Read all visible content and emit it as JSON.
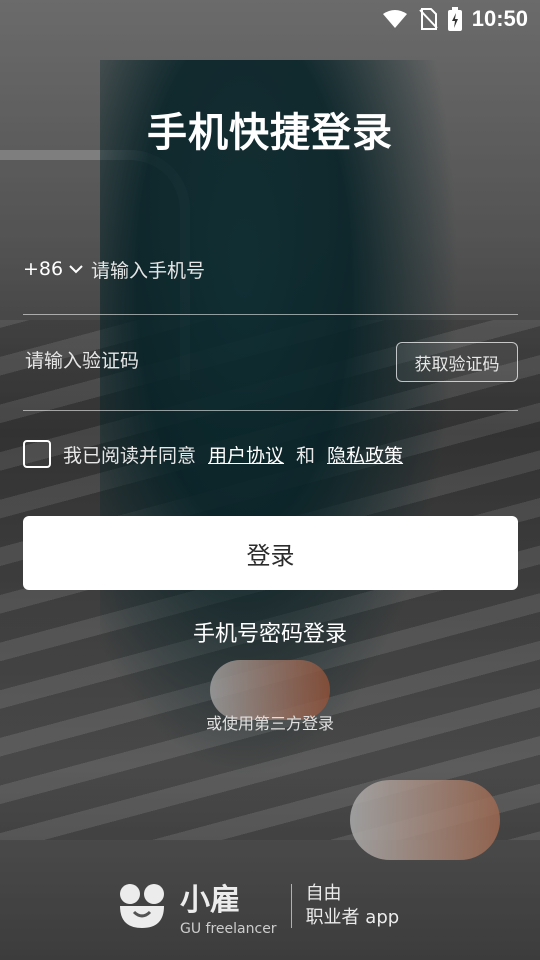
{
  "status_bar": {
    "time": "10:50"
  },
  "title": "手机快捷登录",
  "phone": {
    "country_code": "+86",
    "placeholder": "请输入手机号"
  },
  "code": {
    "placeholder": "请输入验证码",
    "get_code_label": "获取验证码"
  },
  "agreement": {
    "text": "我已阅读并同意",
    "user_agreement": "用户协议",
    "and": "和",
    "privacy_policy": "隐私政策"
  },
  "login_label": "登录",
  "password_login_label": "手机号密码登录",
  "third_party_text": "或使用第三方登录",
  "brand": {
    "name_cn": "小雇",
    "name_en": "GU freelancer",
    "slogan_line1": "自由",
    "slogan_line2": "职业者 app"
  }
}
